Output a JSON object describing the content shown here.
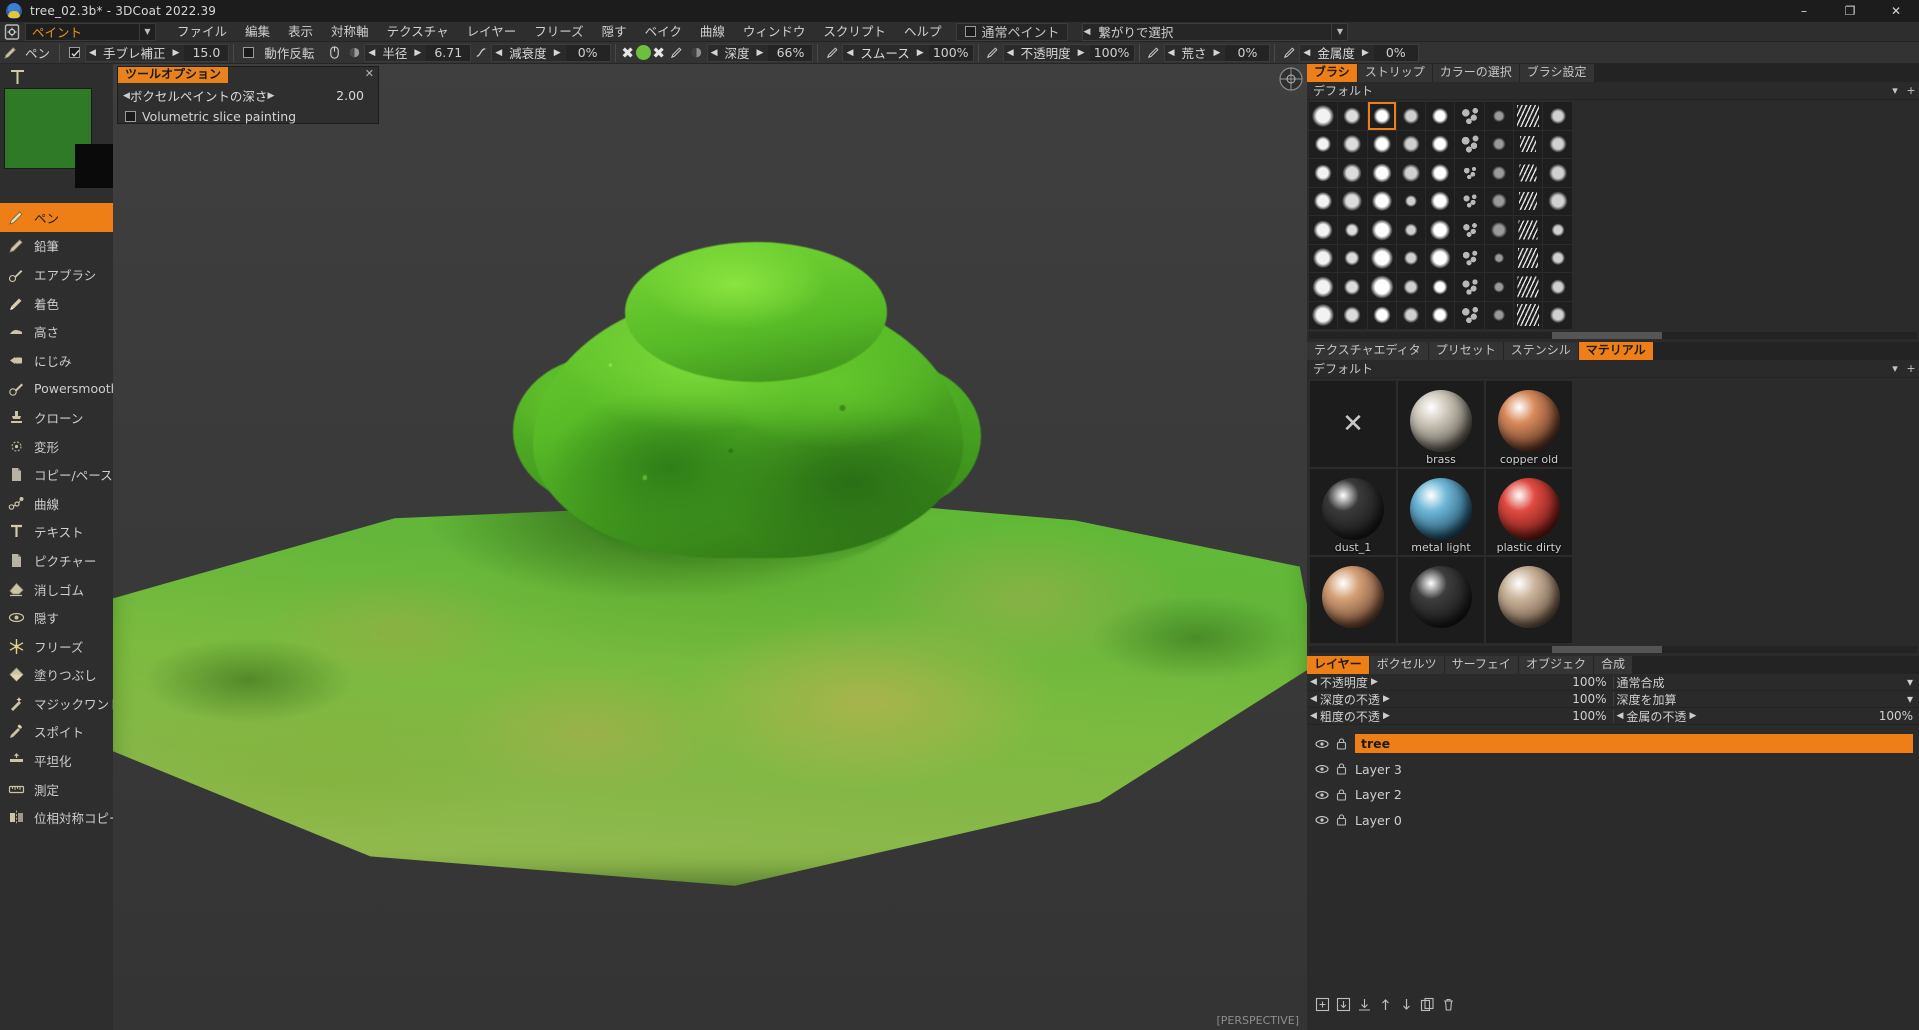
{
  "window": {
    "title": "tree_02.3b* - 3DCoat 2022.39",
    "app_icon": "3dcoat-logo-icon",
    "minimize": "–",
    "maximize": "❐",
    "close": "✕"
  },
  "menubar": {
    "mode_icon": "gear-document-icon",
    "mode_value": "ペイント",
    "dropdown_arrow": "▼",
    "items": [
      "ファイル",
      "編集",
      "表示",
      "対称軸",
      "テクスチャ",
      "レイヤー",
      "フリーズ",
      "隠す",
      "ベイク",
      "曲線",
      "ウィンドウ",
      "スクリプト",
      "ヘルプ"
    ],
    "normal_paint_label": "通常ペイント",
    "selection_label": "繋がりで選択",
    "selection_arrow": "▼"
  },
  "toolbar": {
    "brush_icon": "pen-icon",
    "brush_name": "ペン",
    "stabilizer_checked": true,
    "stabilizer_label": "手ブレ補正",
    "stabilizer_value": "15.0",
    "invert_checked": false,
    "invert_label": "動作反転",
    "mouse_icon": "mouse-icon",
    "pen_pressure_icon": "pressure-icon",
    "radius_label": "半径",
    "radius_value": "6.71",
    "radius_curve_icon": "curve-icon",
    "falloff_label": "減衰度",
    "falloff_value": "0%",
    "swatch_x_left": "✖",
    "swatch_color": "#6fbf3f",
    "swatch_x_right": "✖",
    "depth_pen_icon": "pen-small-icon",
    "depth_label": "深度",
    "depth_value": "66%",
    "smooth_label": "スムース",
    "smooth_value": "100%",
    "opacity_label": "不透明度",
    "opacity_value": "100%",
    "roughness_label": "荒さ",
    "roughness_value": "0%",
    "metal_label": "金属度",
    "metal_value": "0%"
  },
  "tool_options": {
    "title": "ツールオプション",
    "close": "✕",
    "depth_label": "ボクセルペイントの深さ",
    "depth_value": "2.00",
    "volumetric_label": "Volumetric slice painting",
    "volumetric_checked": false
  },
  "left_tools": {
    "preview_color": "#2f7a26",
    "top_icons": [
      "text-tool-icon",
      "transform-overlay-icon"
    ],
    "items": [
      {
        "label": "ペン",
        "icon": "pen-icon",
        "active": true
      },
      {
        "label": "鉛筆",
        "icon": "pencil-icon",
        "active": false
      },
      {
        "label": "エアブラシ",
        "icon": "airbrush-icon",
        "active": false
      },
      {
        "label": "着色",
        "icon": "colorize-icon",
        "active": false
      },
      {
        "label": "高さ",
        "icon": "height-icon",
        "active": false
      },
      {
        "label": "にじみ",
        "icon": "blur-icon",
        "active": false
      },
      {
        "label": "Powersmooth",
        "icon": "powersmooth-icon",
        "active": false
      },
      {
        "label": "クローン",
        "icon": "clone-stamp-icon",
        "active": false
      },
      {
        "label": "変形",
        "icon": "deform-icon",
        "active": false
      },
      {
        "label": "コピー/ペースト",
        "icon": "copy-paste-icon",
        "active": false
      },
      {
        "label": "曲線",
        "icon": "spline-icon",
        "active": false
      },
      {
        "label": "テキスト",
        "icon": "text-icon",
        "active": false
      },
      {
        "label": "ピクチャー",
        "icon": "picture-icon",
        "active": false
      },
      {
        "label": "消しゴム",
        "icon": "eraser-icon",
        "active": false
      },
      {
        "label": "隠す",
        "icon": "eye-hide-icon",
        "active": false
      },
      {
        "label": "フリーズ",
        "icon": "freeze-snowflake-icon",
        "active": false
      },
      {
        "label": "塗りつぶし",
        "icon": "fill-bucket-icon",
        "active": false
      },
      {
        "label": "マジックワンド",
        "icon": "magic-wand-icon",
        "active": false
      },
      {
        "label": "スポイト",
        "icon": "eyedropper-icon",
        "active": false
      },
      {
        "label": "平坦化",
        "icon": "flatten-icon",
        "active": false
      },
      {
        "label": "測定",
        "icon": "measure-icon",
        "active": false
      },
      {
        "label": "位相対称コピー",
        "icon": "topology-symmetry-copy-icon",
        "active": false
      }
    ]
  },
  "viewport": {
    "nav_gizmo_icon": "view-navigation-icon",
    "status": "[PERSPECTIVE]"
  },
  "brush_panel": {
    "tabs": [
      {
        "label": "ブラシ",
        "active": true
      },
      {
        "label": "ストリップ",
        "active": false
      },
      {
        "label": "カラーの選択",
        "active": false
      },
      {
        "label": "ブラシ設定",
        "active": false
      }
    ],
    "preset_name": "デフォルト",
    "collapse_icon": "▾",
    "add_icon": "+",
    "selected_index": 2,
    "columns": 9,
    "rows": 8
  },
  "material_panel": {
    "tabs": [
      {
        "label": "テクスチャエディタ",
        "active": false
      },
      {
        "label": "プリセット",
        "active": false
      },
      {
        "label": "ステンシル",
        "active": false
      },
      {
        "label": "マテリアル",
        "active": true
      }
    ],
    "preset_name": "デフォルト",
    "collapse_icon": "▾",
    "add_icon": "+",
    "none_icon": "✕",
    "items": [
      {
        "label": "",
        "type": "none"
      },
      {
        "label": "brass",
        "color_a": "#cfc9bd",
        "color_b": "#5d584f"
      },
      {
        "label": "copper old",
        "color_a": "#d98a5c",
        "color_b": "#5a3424"
      },
      {
        "label": "dust_1",
        "color_a": "#3a3a3a",
        "color_b": "#181818"
      },
      {
        "label": "metal light",
        "color_a": "#6fb7d8",
        "color_b": "#1e4a63"
      },
      {
        "label": "plastic dirty",
        "color_a": "#e04b42",
        "color_b": "#6b1713"
      },
      {
        "label": "",
        "color_a": "#d5a077",
        "color_b": "#6a4430"
      },
      {
        "label": "",
        "color_a": "#3d3d3d",
        "color_b": "#161616"
      },
      {
        "label": "",
        "color_a": "#cbb49c",
        "color_b": "#6a5542"
      }
    ]
  },
  "layers_panel": {
    "tabs": [
      {
        "label": "レイヤー",
        "active": true
      },
      {
        "label": "ボクセルツ",
        "active": false
      },
      {
        "label": "サーフェイ",
        "active": false
      },
      {
        "label": "オブジェク",
        "active": false
      },
      {
        "label": "合成",
        "active": false
      }
    ],
    "rows": [
      {
        "label": "不透明度",
        "value": "100%",
        "right_label": "通常合成",
        "right_value": "",
        "has_arrow": true
      },
      {
        "label": "深度の不透",
        "value": "100%",
        "right_label": "深度を加算",
        "right_value": "",
        "has_arrow": true
      },
      {
        "label": "粗度の不透",
        "value": "100%",
        "right_label": "金属の不透",
        "right_value": "100%",
        "has_arrow": false
      }
    ],
    "layers": [
      {
        "name": "tree",
        "selected": true,
        "visible": true,
        "locked": true
      },
      {
        "name": "Layer 3",
        "selected": false,
        "visible": true,
        "locked": true
      },
      {
        "name": "Layer 2",
        "selected": false,
        "visible": true,
        "locked": true
      },
      {
        "name": "Layer 0",
        "selected": false,
        "visible": true,
        "locked": true
      }
    ],
    "toolbar_icons": [
      "add-layer-icon",
      "merge-down-icon",
      "merge-visible-icon",
      "move-up-icon",
      "move-down-icon",
      "duplicate-layer-icon",
      "delete-layer-icon"
    ]
  },
  "colors": {
    "accent": "#ee7f16",
    "panel_bg": "#2b2b2b",
    "toolbar_bg": "#333333",
    "viewport_bg": "#3b3b3b",
    "text": "#cdcdcd"
  }
}
